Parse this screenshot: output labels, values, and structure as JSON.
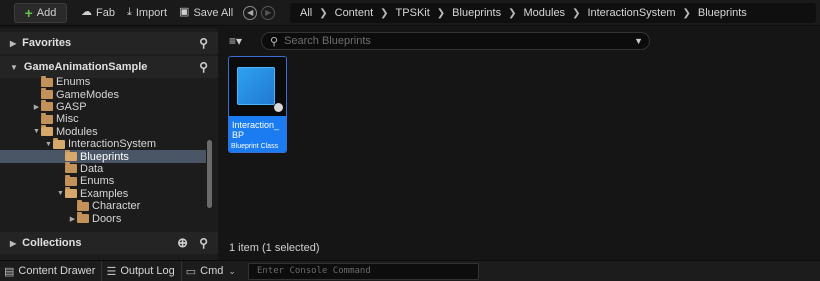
{
  "toolbar": {
    "add_label": "Add",
    "fab_label": "Fab",
    "import_label": "Import",
    "save_all_label": "Save All",
    "breadcrumbs": [
      "All",
      "Content",
      "TPSKit",
      "Blueprints",
      "Modules",
      "InteractionSystem",
      "Blueprints"
    ]
  },
  "sidebar": {
    "favorites_label": "Favorites",
    "project_label": "GameAnimationSample",
    "collections_label": "Collections",
    "tree": [
      {
        "label": "Enums",
        "indent": 2,
        "expander": "",
        "open": false
      },
      {
        "label": "GameModes",
        "indent": 2,
        "expander": "",
        "open": false
      },
      {
        "label": "GASP",
        "indent": 2,
        "expander": "▶",
        "open": false
      },
      {
        "label": "Misc",
        "indent": 2,
        "expander": "",
        "open": false
      },
      {
        "label": "Modules",
        "indent": 2,
        "expander": "▼",
        "open": true
      },
      {
        "label": "InteractionSystem",
        "indent": 3,
        "expander": "▼",
        "open": true
      },
      {
        "label": "Blueprints",
        "indent": 4,
        "expander": "",
        "open": true,
        "selected": true
      },
      {
        "label": "Data",
        "indent": 4,
        "expander": "",
        "open": false
      },
      {
        "label": "Enums",
        "indent": 4,
        "expander": "",
        "open": false
      },
      {
        "label": "Examples",
        "indent": 4,
        "expander": "▼",
        "open": true
      },
      {
        "label": "Character",
        "indent": 5,
        "expander": "",
        "open": false
      },
      {
        "label": "Doors",
        "indent": 5,
        "expander": "▶",
        "open": false
      }
    ]
  },
  "content": {
    "search_placeholder": "Search Blueprints",
    "asset": {
      "name": "Interaction_BP",
      "type": "Blueprint Class"
    },
    "status": "1 item (1 selected)"
  },
  "bottom": {
    "content_drawer": "Content Drawer",
    "output_log": "Output Log",
    "cmd": "Cmd",
    "console_placeholder": "Enter Console Command"
  },
  "colors": {
    "accent": "#1a7cf0",
    "selection": "#4a5566",
    "folder": "#c2925a",
    "add_icon": "#5ec24b"
  }
}
